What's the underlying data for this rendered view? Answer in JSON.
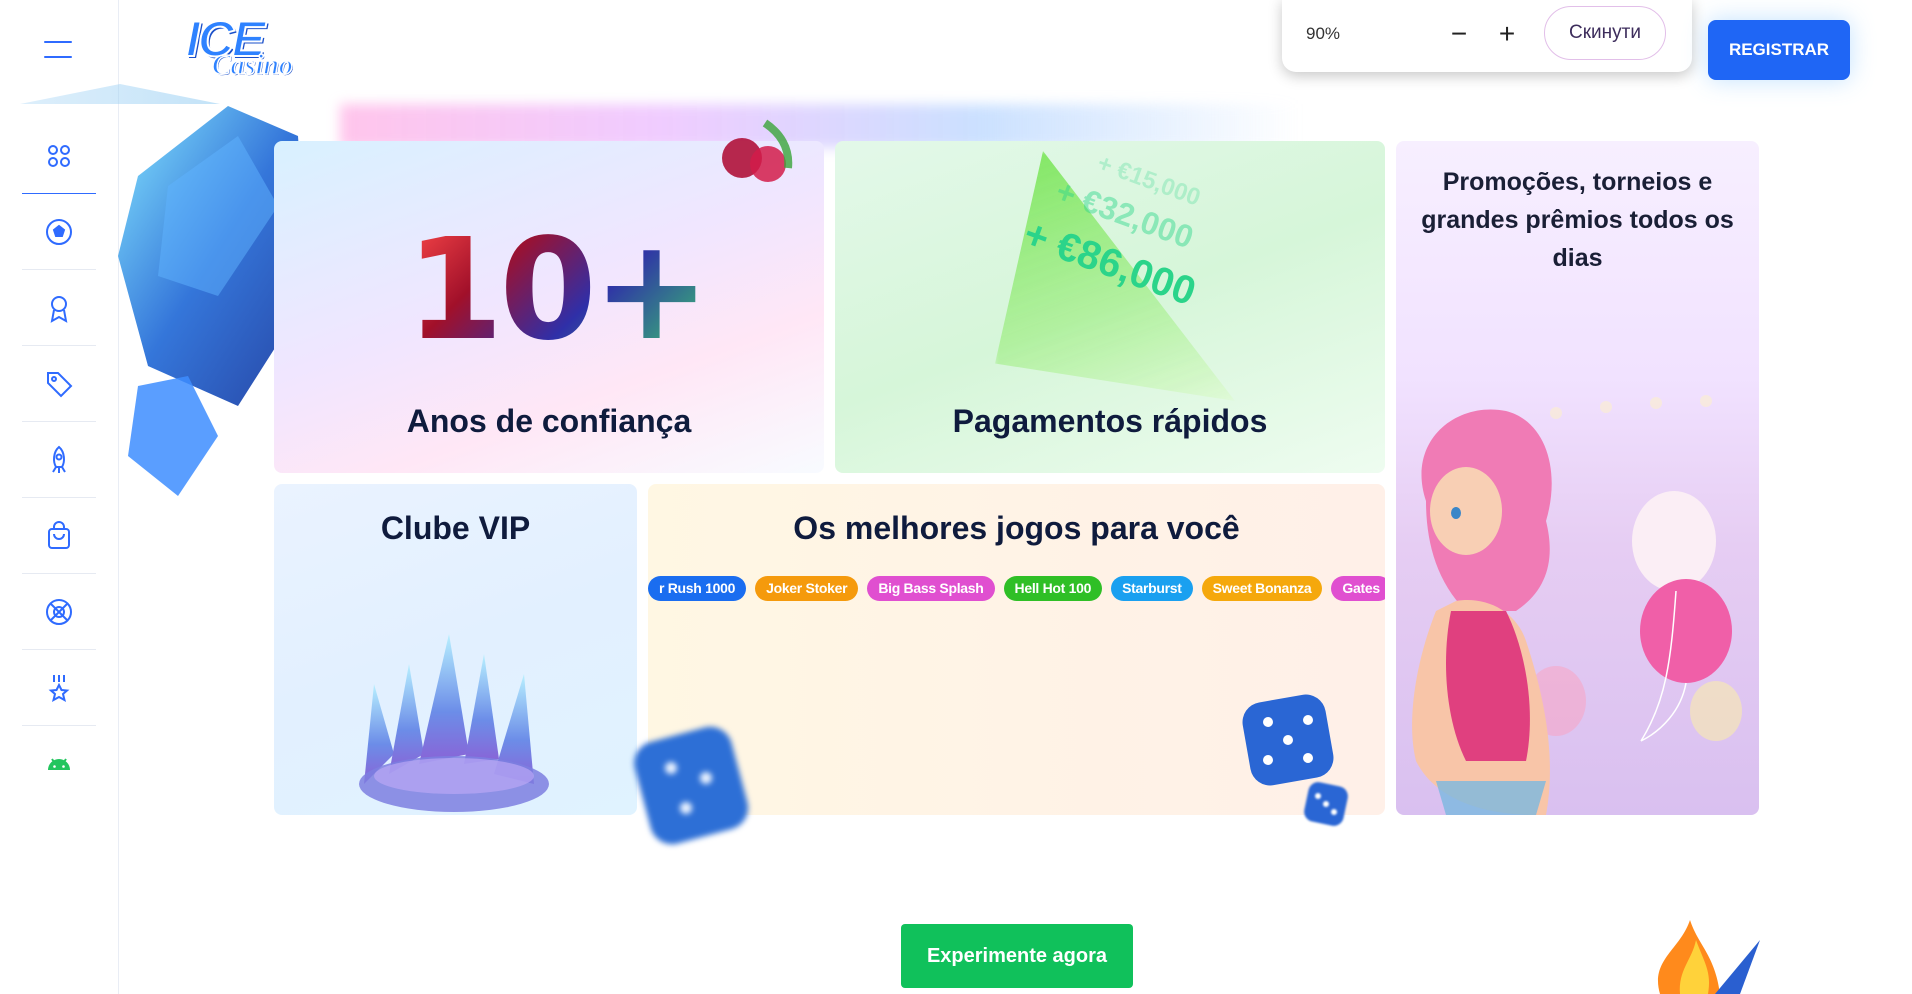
{
  "header": {
    "logo_top": "ICE",
    "logo_bottom": "Casino",
    "zoom": {
      "value": "90%",
      "minus": "−",
      "plus": "+",
      "reset_label": "Скинути"
    },
    "register_label": "REGISTRAR"
  },
  "sidebar": {
    "items": [
      {
        "icon": "grid-icon"
      },
      {
        "icon": "soccer-ball-icon"
      },
      {
        "icon": "award-icon"
      },
      {
        "icon": "tag-icon"
      },
      {
        "icon": "rocket-icon"
      },
      {
        "icon": "shopping-bag-icon"
      },
      {
        "icon": "sports-ball-icon"
      },
      {
        "icon": "medal-icon"
      },
      {
        "icon": "android-icon"
      }
    ]
  },
  "cards": {
    "years": {
      "number": "10+",
      "title": "Anos de confiança"
    },
    "payments": {
      "title": "Pagamentos rápidos",
      "wins": [
        "+ €15,000",
        "+ €32,000",
        "+ €86,000"
      ]
    },
    "promo": {
      "title": "Promoções, torneios e grandes prêmios todos os dias"
    },
    "vip": {
      "title": "Clube VIP"
    },
    "games": {
      "title": "Os melhores jogos para você",
      "tags": [
        "r Rush 1000",
        "Joker Stoker",
        "Big Bass Splash",
        "Hell Hot 100",
        "Starburst",
        "Sweet Bonanza",
        "Gates"
      ]
    }
  },
  "cta": {
    "label": "Experimente agora"
  },
  "colors": {
    "accent": "#1f66f5",
    "cta_green": "#10c15b",
    "tag_colors": [
      "#1a6df0",
      "#f59a0c",
      "#e04fd0",
      "#2fbf26",
      "#1aa0f0",
      "#f5a80c",
      "#e04fd0"
    ]
  }
}
